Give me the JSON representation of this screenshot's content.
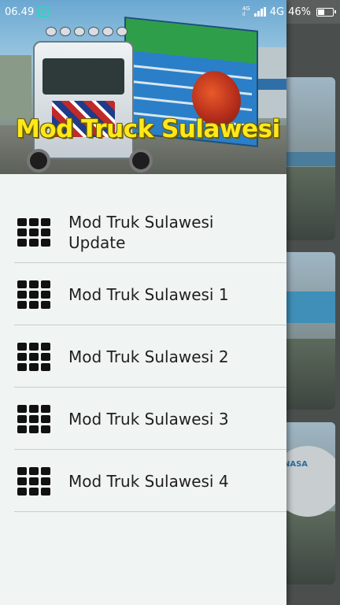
{
  "status_bar": {
    "time": "06.49",
    "network_top": "4G",
    "network_bottom": "ıl",
    "network_label": "4G",
    "battery_percent": "46%",
    "battery_level": 0.46,
    "icons": [
      "screenshot-icon",
      "signal-icon",
      "battery-icon"
    ]
  },
  "drawer": {
    "header_title": "Mod Truck Sulawesi",
    "items": [
      {
        "label": "Mod Truk Sulawesi\nUpdate",
        "icon": "apps-grid-icon"
      },
      {
        "label": "Mod Truk Sulawesi 1",
        "icon": "apps-grid-icon"
      },
      {
        "label": "Mod Truk Sulawesi 2",
        "icon": "apps-grid-icon"
      },
      {
        "label": "Mod Truk Sulawesi 3",
        "icon": "apps-grid-icon"
      },
      {
        "label": "Mod Truk Sulawesi 4",
        "icon": "apps-grid-icon"
      }
    ]
  },
  "background": {
    "card_labels": [
      "",
      "",
      "NASA"
    ]
  },
  "colors": {
    "drawer_bg": "#f0f4f2",
    "title_yellow": "#ffe81a",
    "icon_black": "#111111",
    "divider": "#c9cfcc"
  }
}
